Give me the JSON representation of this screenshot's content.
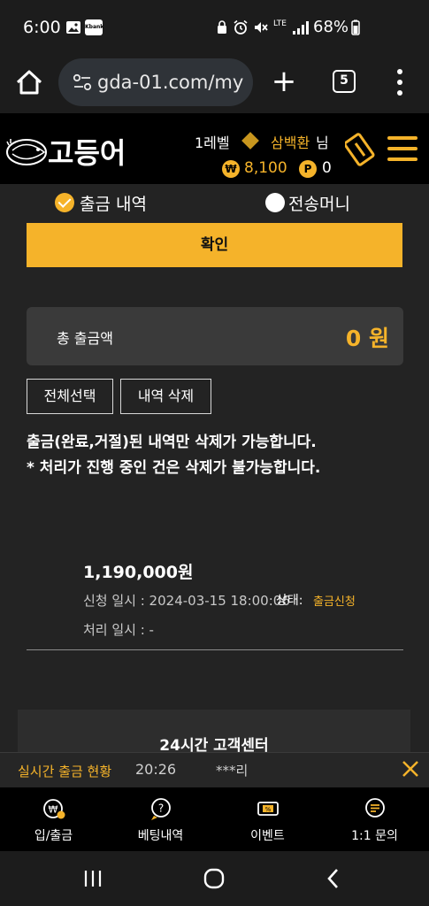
{
  "status_bar": {
    "time": "6:00",
    "app_badge": "Kbank",
    "network": "LTE",
    "battery": "68%"
  },
  "browser": {
    "url": "gda-01.com/my",
    "tab_count": "5"
  },
  "header": {
    "logo_text": "고등어",
    "level": "1레벨",
    "username": "삼백환",
    "honorific": "님",
    "money_symbol": "₩",
    "money": "8,100",
    "point_symbol": "P",
    "points": "0"
  },
  "filter": {
    "options": [
      {
        "label": "출금 내역",
        "checked": true
      },
      {
        "label": "전송머니",
        "checked": false
      }
    ],
    "confirm_label": "확인"
  },
  "summary": {
    "label": "총 출금액",
    "value": "0 원"
  },
  "actions": {
    "select_all": "전체선택",
    "delete": "내역 삭제"
  },
  "notice": {
    "line1": "출금(완료,거절)된 내역만 삭제가 가능합니다.",
    "line2": "* 처리가 진행 중인 건은 삭제가 불가능합니다."
  },
  "history": [
    {
      "amount": "1,190,000원",
      "request_label": "신청 일시 : 2024-03-15 18:00:06",
      "status_label": "상태:",
      "status": "출금신청",
      "process_label": "처리 일시 : -"
    }
  ],
  "customer_center": {
    "title": "24시간 고객센터"
  },
  "ticker": {
    "label": "실시간 출금 현황",
    "time": "20:26",
    "user": "***리"
  },
  "bottom_nav": [
    {
      "label": "입/출금",
      "icon": "deposit-withdraw-icon"
    },
    {
      "label": "베팅내역",
      "icon": "betting-history-icon"
    },
    {
      "label": "이벤트",
      "icon": "event-ticket-icon"
    },
    {
      "label": "1:1 문의",
      "icon": "chat-inquiry-icon"
    }
  ],
  "colors": {
    "accent": "#f5b32a",
    "background": "#232323",
    "header": "#000000"
  }
}
